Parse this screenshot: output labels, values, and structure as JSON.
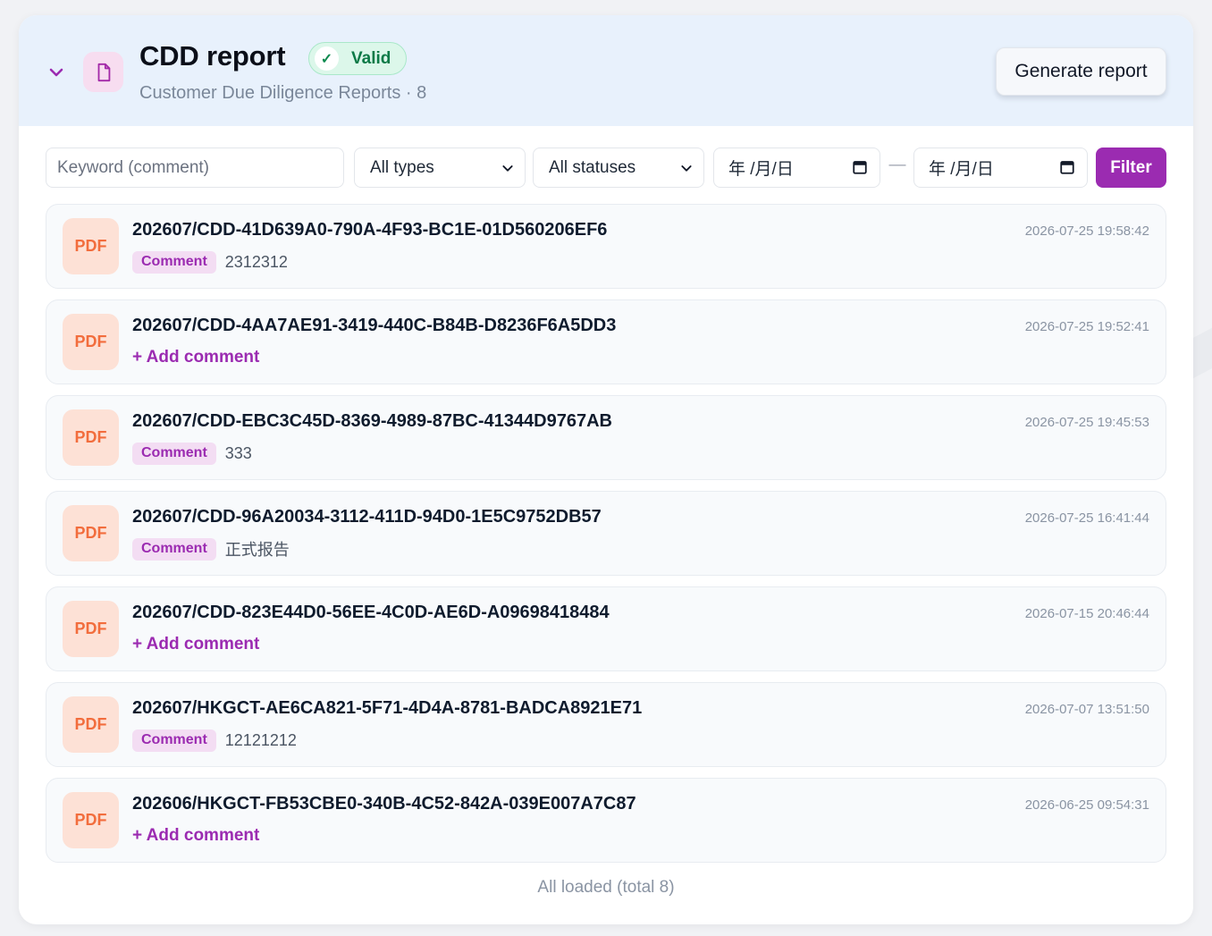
{
  "header": {
    "title": "CDD report",
    "status_label": "Valid",
    "status_icon": "check-icon",
    "subtitle": "Customer Due Diligence Reports · 8",
    "generate_label": "Generate report"
  },
  "filters": {
    "keyword_placeholder": "Keyword (comment)",
    "type_select": "All types",
    "status_select": "All statuses",
    "date_from": "年 /月/日",
    "date_separator": "—",
    "date_to": "年 /月/日",
    "filter_label": "Filter"
  },
  "labels": {
    "file_type": "PDF",
    "comment_tag": "Comment",
    "add_comment": "+ Add comment"
  },
  "reports": [
    {
      "name": "202607/CDD-41D639A0-790A-4F93-BC1E-01D560206EF6",
      "time": "2026-07-25 19:58:42",
      "comment": "2312312"
    },
    {
      "name": "202607/CDD-4AA7AE91-3419-440C-B84B-D8236F6A5DD3",
      "time": "2026-07-25 19:52:41",
      "comment": ""
    },
    {
      "name": "202607/CDD-EBC3C45D-8369-4989-87BC-41344D9767AB",
      "time": "2026-07-25 19:45:53",
      "comment": "333"
    },
    {
      "name": "202607/CDD-96A20034-3112-411D-94D0-1E5C9752DB57",
      "time": "2026-07-25 16:41:44",
      "comment": "正式报告"
    },
    {
      "name": "202607/CDD-823E44D0-56EE-4C0D-AE6D-A09698418484",
      "time": "2026-07-15 20:46:44",
      "comment": ""
    },
    {
      "name": "202607/HKGCT-AE6CA821-5F71-4D4A-8781-BADCA8921E71",
      "time": "2026-07-07 13:51:50",
      "comment": "12121212"
    },
    {
      "name": "202606/HKGCT-FB53CBE0-340B-4C52-842A-039E007A7C87",
      "time": "2026-06-25 09:54:31",
      "comment": ""
    }
  ],
  "footer": {
    "status": "All loaded (total 8)"
  },
  "colors": {
    "accent": "#9b2bb1",
    "header_bg": "#e8f1fc",
    "valid_bg": "#dcf7ea",
    "valid_text": "#0c7a47",
    "pdf_tile_bg": "#fde1d6",
    "pdf_tile_text": "#f26d3d"
  }
}
